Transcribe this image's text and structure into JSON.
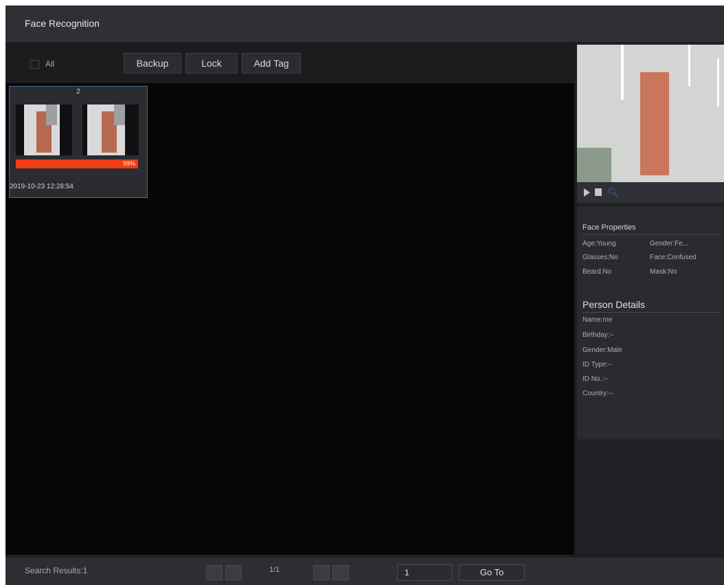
{
  "window": {
    "title": "Face Recognition"
  },
  "toolbar": {
    "select_all_label": "All",
    "backup_label": "Backup",
    "lock_label": "Lock",
    "add_tag_label": "Add Tag"
  },
  "results": [
    {
      "index": "2",
      "similarity": "99%",
      "timestamp": "2019-10-23 12:28:54"
    }
  ],
  "preview": {
    "controls": [
      "play-icon",
      "stop-icon",
      "zoom-icon"
    ]
  },
  "face_properties": {
    "heading": "Face Properties",
    "age": "Age:Young",
    "gender": "Gender:Fe...",
    "glasses": "Glasses:No",
    "face": "Face:Confused",
    "beard": "Beard:No",
    "mask": "Mask:No"
  },
  "person_details": {
    "heading": "Person Details",
    "name": "Name:me",
    "birthday": "Birthday:--",
    "gender": "Gender:Male",
    "id_type": "ID Type:--",
    "id_no": "ID No.:--",
    "country": "Country:--"
  },
  "footer": {
    "search_results": "Search Results:1",
    "page": "1/1",
    "goto_value": "1",
    "goto_label": "Go To"
  },
  "colors": {
    "similarity_bar": "#ee3c17",
    "selected_border": "#3f6d93",
    "zoom_icon": "#3a77c3"
  }
}
